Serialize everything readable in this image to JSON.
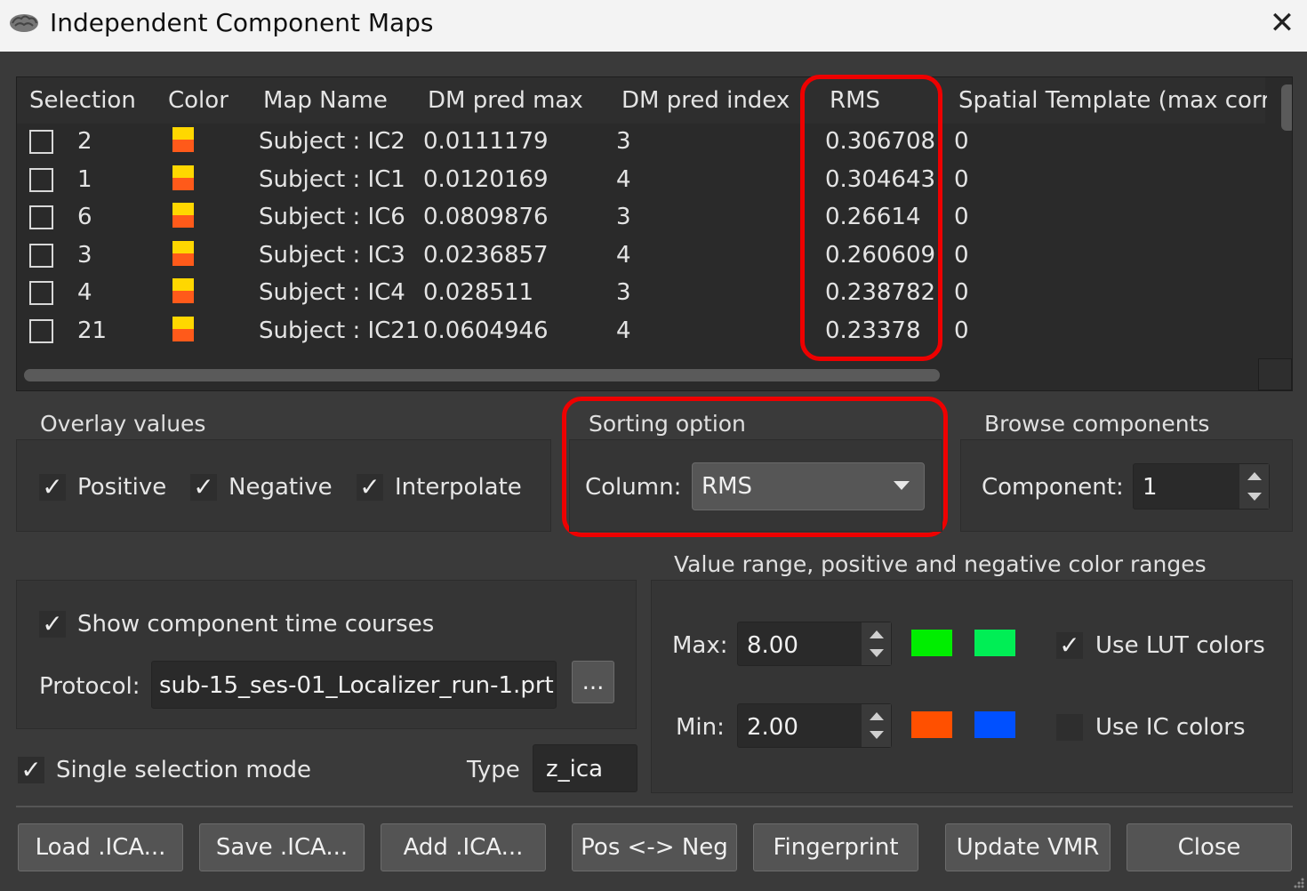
{
  "window": {
    "title": "Independent Component Maps",
    "close_glyph": "✕"
  },
  "table": {
    "headers": [
      "Selection",
      "Color",
      "Map Name",
      "DM pred max",
      "DM pred index",
      "RMS",
      "Spatial Template (max corr)"
    ],
    "rows": [
      {
        "selection": "2",
        "map_name": "Subject : IC2",
        "dm_pred_max": "0.0111179",
        "dm_pred_index": "3",
        "rms": "0.306708",
        "spatial_template": "0"
      },
      {
        "selection": "1",
        "map_name": "Subject : IC1",
        "dm_pred_max": "0.0120169",
        "dm_pred_index": "4",
        "rms": "0.304643",
        "spatial_template": "0"
      },
      {
        "selection": "6",
        "map_name": "Subject : IC6",
        "dm_pred_max": "0.0809876",
        "dm_pred_index": "3",
        "rms": "0.26614",
        "spatial_template": "0"
      },
      {
        "selection": "3",
        "map_name": "Subject : IC3",
        "dm_pred_max": "0.0236857",
        "dm_pred_index": "4",
        "rms": "0.260609",
        "spatial_template": "0"
      },
      {
        "selection": "4",
        "map_name": "Subject : IC4",
        "dm_pred_max": "0.028511",
        "dm_pred_index": "3",
        "rms": "0.238782",
        "spatial_template": "0"
      },
      {
        "selection": "21",
        "map_name": "Subject : IC21",
        "dm_pred_max": "0.0604946",
        "dm_pred_index": "4",
        "rms": "0.23378",
        "spatial_template": "0"
      }
    ],
    "swatch_colors": {
      "top": "#ffd700",
      "bottom": "#ff5a1a"
    }
  },
  "overlay": {
    "title": "Overlay values",
    "positive": "Positive",
    "negative": "Negative",
    "interpolate": "Interpolate",
    "check": "✓"
  },
  "sorting": {
    "title": "Sorting option",
    "column_label": "Column:",
    "column_value": "RMS"
  },
  "browse": {
    "title": "Browse components",
    "component_label": "Component:",
    "component_value": "1"
  },
  "timecourses": {
    "show_label": "Show component time courses",
    "protocol_label": "Protocol:",
    "protocol_value": "sub-15_ses-01_Localizer_run-1.prt",
    "browse_button": "..."
  },
  "single_selection": {
    "label": "Single selection mode",
    "type_label": "Type",
    "type_value": "z_ica"
  },
  "value_range": {
    "title": "Value range, positive and negative color ranges",
    "max_label": "Max:",
    "max_value": "8.00",
    "min_label": "Min:",
    "min_value": "2.00",
    "use_lut": "Use LUT colors",
    "use_ic": "Use IC colors",
    "colors": {
      "max_pos": "#00ee00",
      "max_neg": "#00ee55",
      "min_pos": "#ff5000",
      "min_neg": "#0050ff"
    }
  },
  "buttons": {
    "load": "Load .ICA...",
    "save": "Save .ICA...",
    "add": "Add .ICA...",
    "posneg": "Pos <-> Neg",
    "fingerprint": "Fingerprint",
    "update": "Update VMR",
    "close": "Close"
  },
  "highlight_color": "#ee0000"
}
